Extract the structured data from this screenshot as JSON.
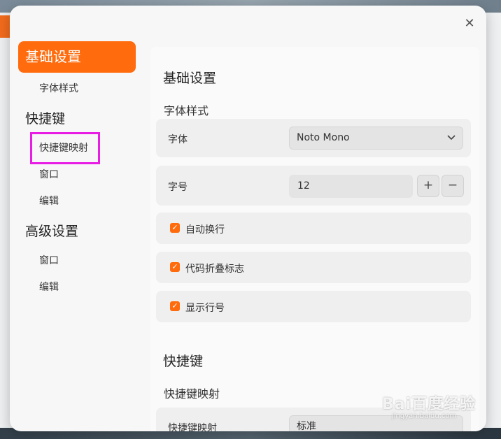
{
  "dialog": {
    "close_icon": "close-icon"
  },
  "sidebar": {
    "active_item": "基础设置",
    "sub_font_style": "字体样式",
    "group_shortcuts": "快捷键",
    "sub_shortcut_map": "快捷键映射",
    "sub_window_1": "窗口",
    "sub_edit_1": "编辑",
    "group_advanced": "高级设置",
    "sub_window_2": "窗口",
    "sub_edit_2": "编辑"
  },
  "content": {
    "section_basic": "基础设置",
    "sub_font_style": "字体样式",
    "font_label": "字体",
    "font_value": "Noto Mono",
    "size_label": "字号",
    "size_value": "12",
    "plus": "+",
    "minus": "−",
    "wrap_label": "自动换行",
    "fold_label": "代码折叠标志",
    "lineno_label": "显示行号",
    "section_shortcuts": "快捷键",
    "sub_shortcut_map": "快捷键映射",
    "shortcut_map_label": "快捷键映射",
    "shortcut_map_value": "标准"
  },
  "checkbox": {
    "wrap": true,
    "fold": true,
    "lineno": true,
    "mark": "✓"
  },
  "watermark": {
    "logo": "Bai百度经验",
    "url": "jingyan.baidu.com"
  },
  "colors": {
    "accent": "#ff6b0d",
    "highlight": "#e81ce4"
  }
}
